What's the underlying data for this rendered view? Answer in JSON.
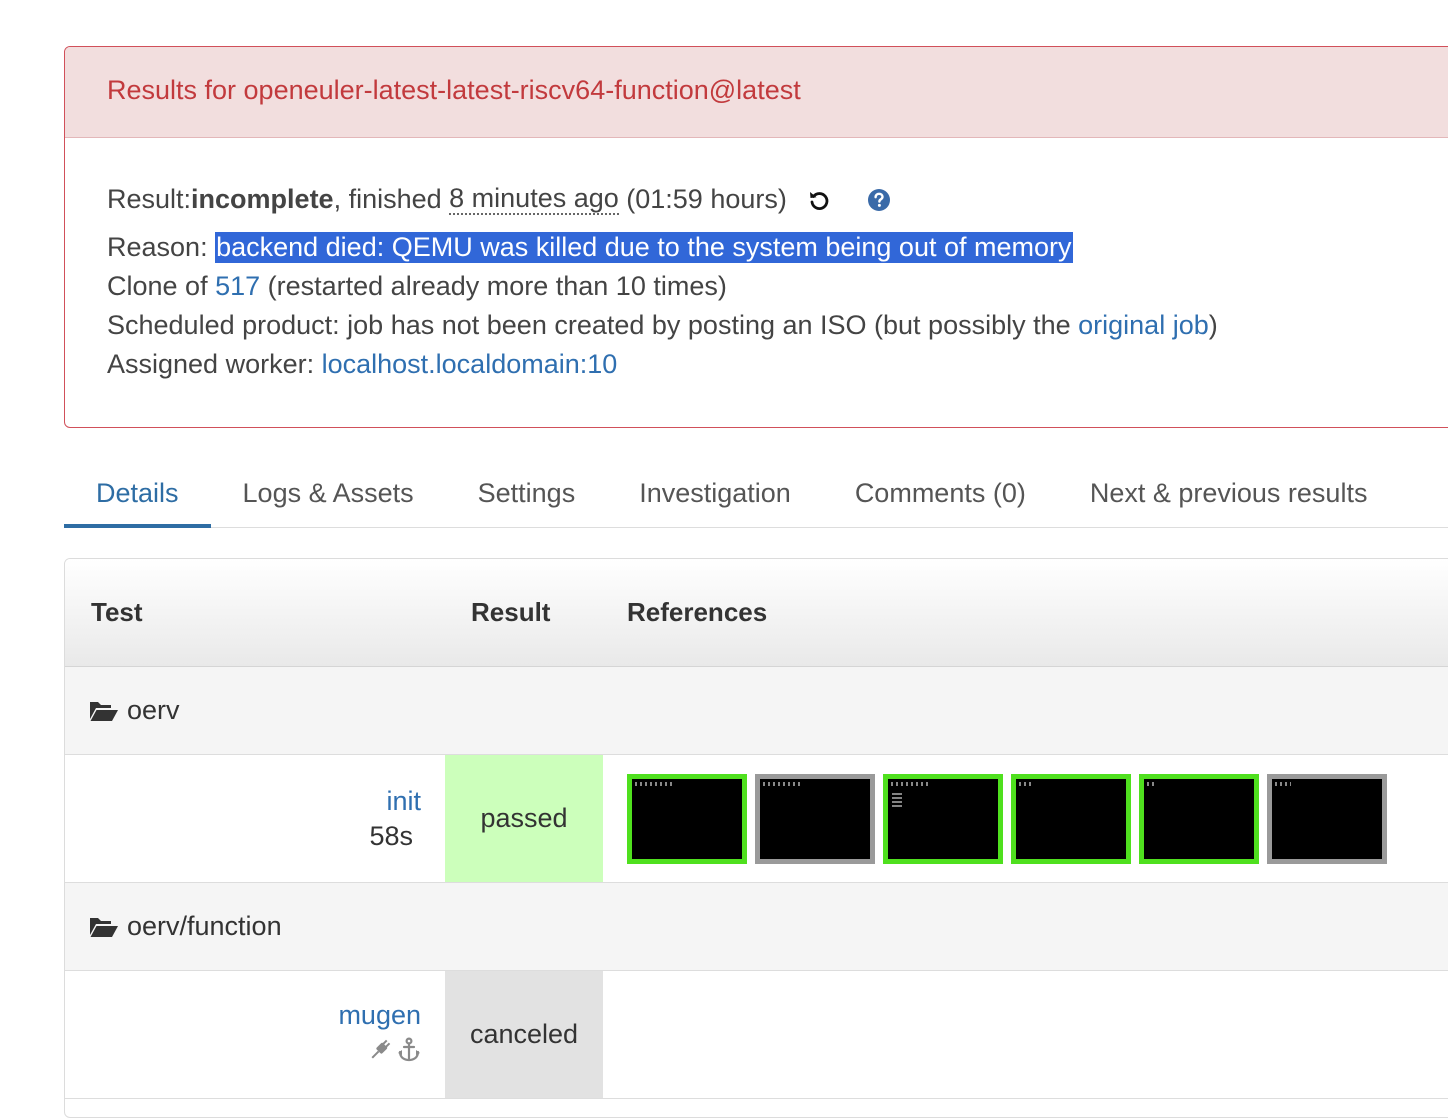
{
  "panel": {
    "title": "Results for openeuler-latest-latest-riscv64-function@latest",
    "result_label": "Result: ",
    "result_value": "incomplete",
    "finished_text": ", finished ",
    "finished_ago": "8 minutes ago",
    "duration": " (01:59 hours)",
    "reason_label": "Reason: ",
    "reason_value": "backend died: QEMU was killed due to the system being out of memory",
    "clone_label": "Clone of ",
    "clone_link": "517",
    "clone_note": " (restarted already more than 10 times)",
    "scheduled_text": "Scheduled product: job has not been created by posting an ISO (but possibly the ",
    "scheduled_link": "original job",
    "scheduled_close": ")",
    "worker_label": "Assigned worker: ",
    "worker_link": "localhost.localdomain:10",
    "icons": [
      "restart-icon",
      "help-icon"
    ]
  },
  "tabs": [
    {
      "label": "Details",
      "active": true
    },
    {
      "label": "Logs & Assets"
    },
    {
      "label": "Settings"
    },
    {
      "label": "Investigation"
    },
    {
      "label": "Comments (0)"
    },
    {
      "label": "Next & previous results"
    }
  ],
  "table": {
    "headers": [
      "Test",
      "Result",
      "References"
    ],
    "groups": [
      {
        "name": "oerv",
        "tests": [
          {
            "name": "init",
            "duration": "58s",
            "result": "passed",
            "thumbnails": [
              "ok",
              "neutral",
              "ok",
              "ok",
              "ok",
              "neutral"
            ]
          }
        ]
      },
      {
        "name": "oerv/function",
        "tests": [
          {
            "name": "mugen",
            "result": "canceled",
            "icons": [
              "plug-icon",
              "anchor-icon"
            ]
          }
        ]
      }
    ]
  }
}
